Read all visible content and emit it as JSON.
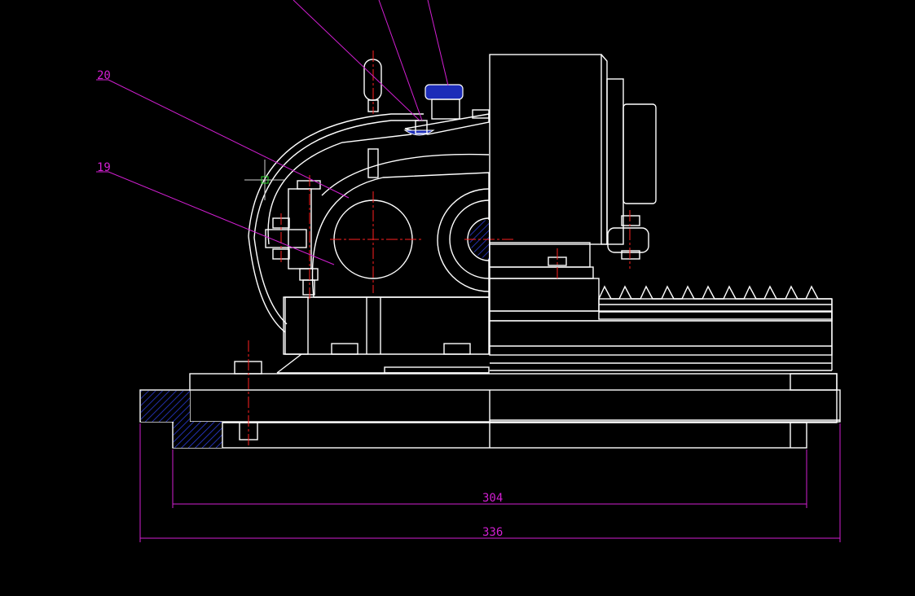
{
  "drawing": {
    "balloons": [
      {
        "id": "balloon-20",
        "label": "20"
      },
      {
        "id": "balloon-19",
        "label": "19"
      }
    ],
    "dimensions": [
      {
        "id": "dim-304",
        "value": "304"
      },
      {
        "id": "dim-336",
        "value": "336"
      }
    ]
  },
  "colors": {
    "background": "#000000",
    "outline": "#ffffff",
    "centerline": "#ff2020",
    "dimension": "#d21fd2",
    "hatch": "#1c2cb8"
  }
}
